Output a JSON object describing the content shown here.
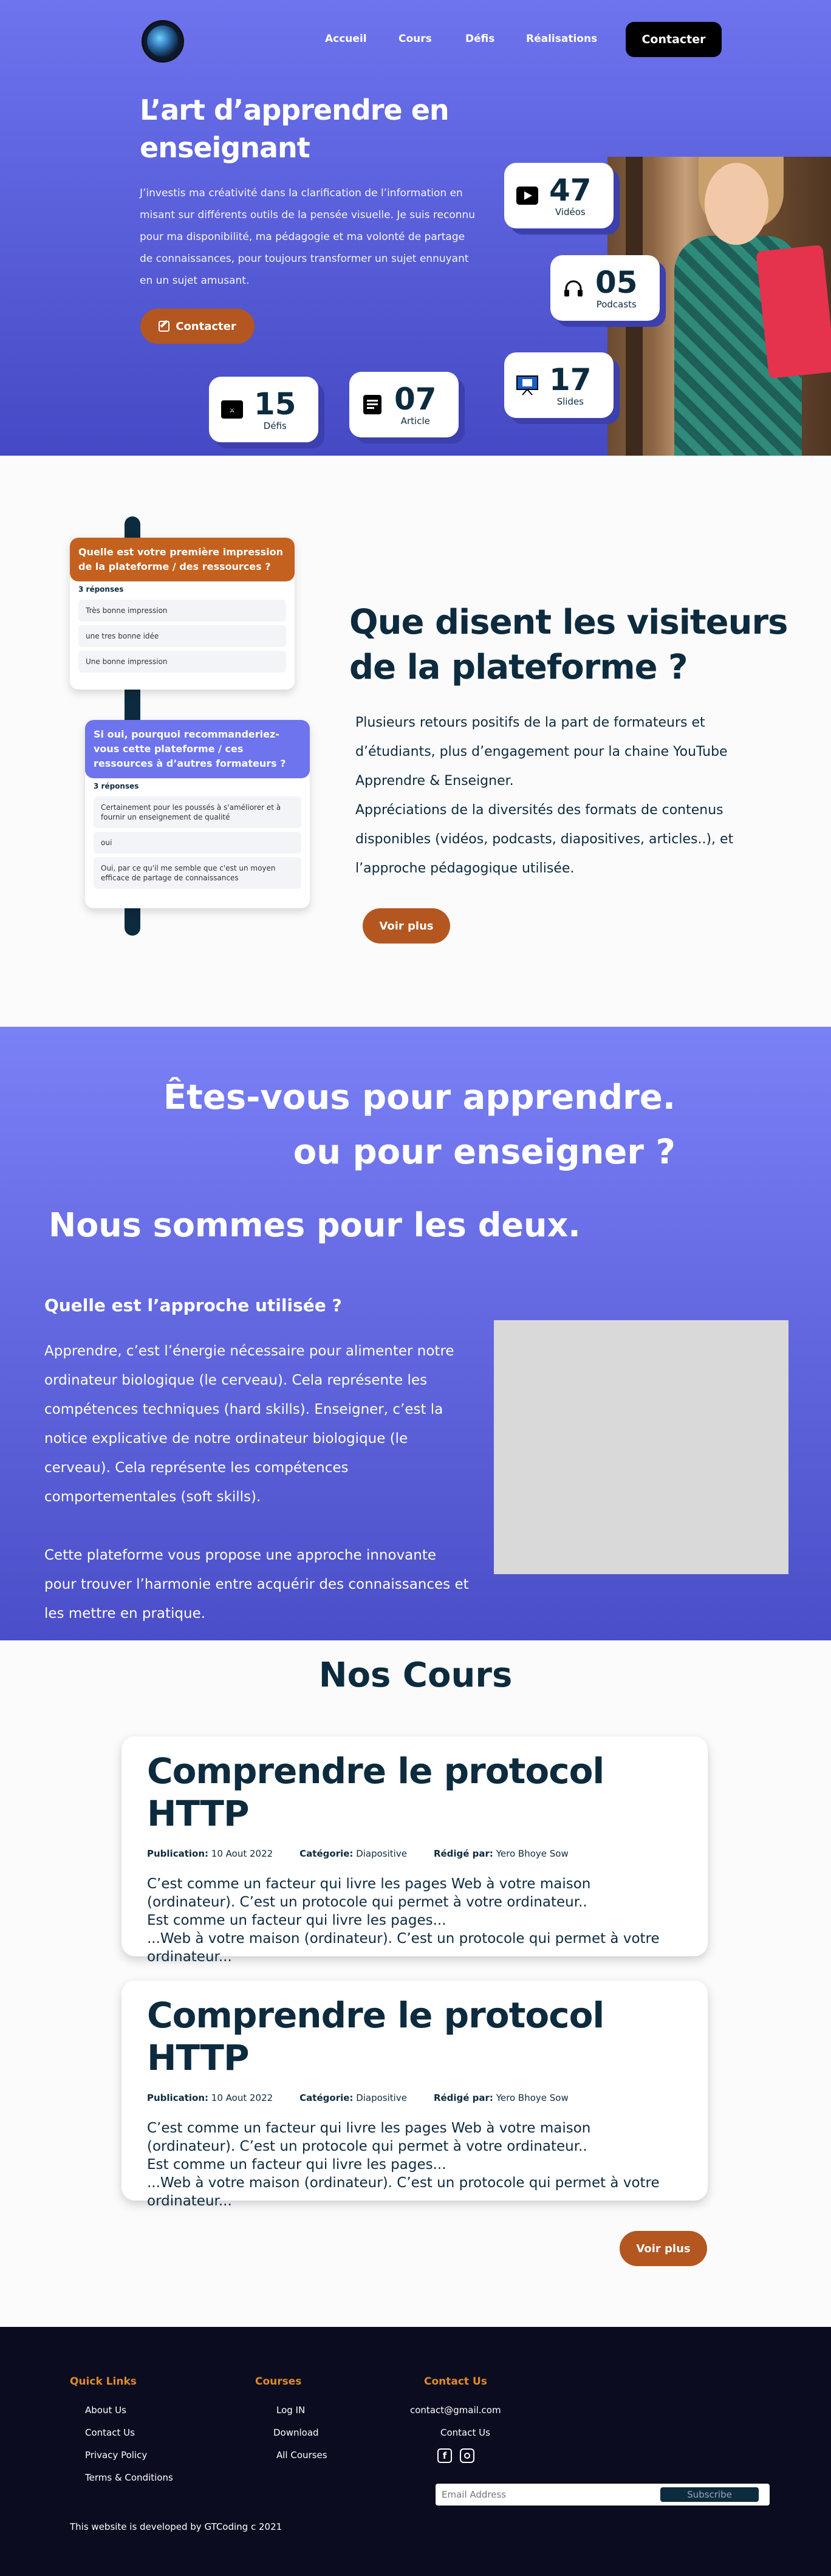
{
  "nav": {
    "links": [
      "Accueil",
      "Cours",
      "Défis",
      "Réalisations"
    ],
    "cta": "Contacter"
  },
  "hero": {
    "title_line1": "L’art d’apprendre en",
    "title_line2": "enseignant",
    "text": "J’investis ma créativité dans la clarification de l’information en misant sur différents outils de la pensée visuelle. Je suis reconnu pour ma disponibilité, ma pédagogie et ma volonté de partage de connaissances, pour toujours transformer un sujet ennuyant en un sujet amusant.",
    "cta": "Contacter",
    "stats": [
      {
        "value": "47",
        "label": "Vidéos",
        "icon": "play-icon"
      },
      {
        "value": "05",
        "label": "Podcasts",
        "icon": "headphones-icon"
      },
      {
        "value": "17",
        "label": "Slides",
        "icon": "presentation-icon"
      },
      {
        "value": "15",
        "label": "Défis",
        "icon": "versus-icon"
      },
      {
        "value": "07",
        "label": "Article",
        "icon": "article-icon"
      }
    ]
  },
  "testimonials": {
    "title_line1": "Que disent les visiteurs",
    "title_line2": "de la plateforme ?",
    "text1": "Plusieurs retours positifs de la part de formateurs et d’étudiants, plus d’engagement pour la chaine YouTube Apprendre & Enseigner.",
    "text2": "Appréciations de la diversités des formats de contenus disponibles (vidéos, podcasts, diapositives, articles..), et l’approche pédagogique utilisée.",
    "cta": "Voir plus",
    "poll1": {
      "question": "Quelle est votre première impression de la plateforme / des ressources ?",
      "count": "3 réponses",
      "options": [
        "Très bonne impression",
        "une tres bonne idée",
        "Une bonne impression"
      ]
    },
    "poll2": {
      "question": "Si oui, pourquoi recommanderiez-vous cette plateforme / ces ressources à d’autres formateurs ?",
      "count": "3 réponses",
      "options": [
        "Certainement pour les poussés à s'améliorer et à fournir un enseignement de qualité",
        "oui",
        "Oui, par ce qu'il me semble que c'est un moyen efficace de partage de connaissances"
      ]
    }
  },
  "approach": {
    "title_line1": "Êtes-vous pour apprendre.",
    "title_line2": "ou pour enseigner ?",
    "subtitle": "Nous sommes pour les deux.",
    "question": "Quelle est l’approche utilisée ?",
    "text1": "Apprendre, c’est l’énergie nécessaire pour alimenter notre ordinateur biologique (le cerveau). Cela représente les compétences techniques (hard skills). Enseigner, c’est la notice explicative de notre ordinateur biologique (le cerveau). Cela représente les compétences comportementales (soft skills).",
    "text2": "Cette plateforme vous propose une approche innovante pour trouver l’harmonie entre acquérir des connaissances et les mettre en pratique."
  },
  "courses": {
    "title": "Nos Cours",
    "cta": "Voir plus",
    "items": [
      {
        "title": "Comprendre le protocol HTTP",
        "pub_label": "Publication:",
        "pub_value": "10 Aout 2022",
        "cat_label": "Catégorie:",
        "cat_value": "Diapositive",
        "author_label": "Rédigé par:",
        "author_value": "Yero Bhoye Sow",
        "text1": "C’est comme un facteur qui livre les pages Web à votre maison (ordinateur). C’est un protocole qui permet à votre ordinateur..",
        "text2": "Est comme un facteur qui livre les pages...",
        "text3": "...Web à votre maison (ordinateur). C’est un protocole qui permet à votre ordinateur..."
      },
      {
        "title": "Comprendre le protocol HTTP",
        "pub_label": "Publication:",
        "pub_value": "10 Aout 2022",
        "cat_label": "Catégorie:",
        "cat_value": "Diapositive",
        "author_label": "Rédigé par:",
        "author_value": "Yero Bhoye Sow",
        "text1": "C’est comme un facteur qui livre les pages Web à votre maison (ordinateur). C’est un protocole qui permet à votre ordinateur..",
        "text2": "Est comme un facteur qui livre les pages...",
        "text3": "...Web à votre maison (ordinateur). C’est un protocole qui permet à votre ordinateur..."
      }
    ]
  },
  "footer": {
    "quick_title": "Quick Links",
    "quick": [
      "About Us",
      "Contact Us",
      "Privacy Policy",
      "Terms & Conditions"
    ],
    "courses_title": "Courses",
    "courses": [
      "Log IN",
      "Download",
      "All Courses"
    ],
    "contact_title": "Contact Us",
    "email": "contact@gmail.com",
    "contact_link": "Contact Us",
    "email_placeholder": "Email Address",
    "subscribe": "Subscribe",
    "credit": "This website is developed by GTCoding c 2021"
  },
  "colors": {
    "accent": "#6d74ee",
    "orange": "#b4561f",
    "dark": "#0d2b3e",
    "footer": "#0b0c1f"
  }
}
